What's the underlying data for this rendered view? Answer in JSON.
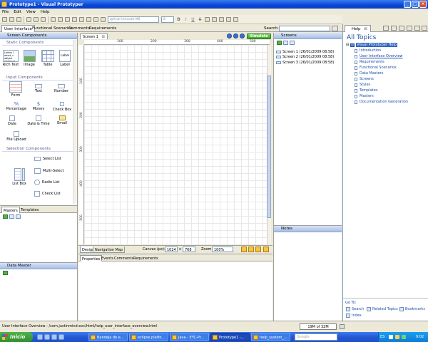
{
  "window": {
    "title": "Prototype1 - Visual Prototyper"
  },
  "menu": [
    "File",
    "Edit",
    "View",
    "Help"
  ],
  "toolbar": {
    "font_value": "@Arial Unicode MS",
    "size_value": "8",
    "format": [
      "B",
      "I",
      "U",
      "S"
    ]
  },
  "tabs": {
    "main": [
      "User Interface",
      "Functional Scenarios",
      "Comments",
      "Requirements"
    ],
    "search_label": "Search:"
  },
  "left_panel": {
    "title": "Screen Components",
    "sections": {
      "static": "Static Components",
      "input": "Input Components",
      "selection": "Selection Components"
    },
    "static_items": [
      "Rich Text",
      "Image",
      "Table",
      "Label"
    ],
    "rich_text_preview": "Lorem i amet, c adipisi ullamcor",
    "label_preview": "Label",
    "input_items": [
      "Form",
      "Text",
      "Number",
      "Percentage",
      "Money",
      "Check Box",
      "Date",
      "Date & Time",
      "Email",
      "File Upload"
    ],
    "selection_items": [
      "List Box",
      "Select List",
      "Multi-Select",
      "Radio List",
      "Check List"
    ],
    "icon_glyphs": {
      "percentage": "%",
      "money": "$"
    }
  },
  "masters_panel": {
    "tabs": [
      "Masters",
      "Templates"
    ]
  },
  "data_master": {
    "title": "Data Master"
  },
  "canvas": {
    "tab_label": "Screen 1",
    "simulate_label": "Simulate",
    "ruler_top": [
      "100",
      "200",
      "300",
      "400",
      "500"
    ],
    "ruler_left": [
      "100",
      "200",
      "300",
      "400",
      "500"
    ]
  },
  "canvas_bar": {
    "tabs": [
      "Design",
      "Navigation Map"
    ],
    "canvas_label": "Canvas (px):",
    "width": "1024",
    "x_sep": "x",
    "height": "768",
    "zoom_label": "Zoom:",
    "zoom_value": "100%"
  },
  "properties": {
    "tabs": [
      "Properties",
      "Events",
      "Comments",
      "Requirements"
    ]
  },
  "screens_panel": {
    "title": "Screens",
    "items": [
      "Screen 1 (26/01/2009 08:58)",
      "Screen 2 (26/01/2009 08:58)",
      "Screen 3 (26/01/2009 08:58)"
    ]
  },
  "notes_panel": {
    "title": "Notes"
  },
  "help": {
    "tab": "Help",
    "heading": "All Topics",
    "root": "Visual Prototyper Help",
    "items": [
      "Introduction",
      "User Interface Overview",
      "Requirements",
      "Functional Scenarios",
      "Data Masters",
      "Screens",
      "Styles",
      "Templates",
      "Masters",
      "Documentation Generation"
    ],
    "goto": "Go To:",
    "links": [
      "Search",
      "Related Topics",
      "Bookmarks",
      "Index"
    ]
  },
  "status": {
    "text": "User Interface Overview - /com.justinmind.evc/html/help_user_interface_overview.html",
    "memory": "19M of 32M"
  },
  "taskbar": {
    "start": "Inicio",
    "items": [
      "Bandeja de e...",
      "eclipse.platfo...",
      "Java - EYC-Pr...",
      "Prototype1 -...",
      "help_system_..."
    ],
    "google": "Google",
    "lang": "ES",
    "time": "9:02"
  }
}
